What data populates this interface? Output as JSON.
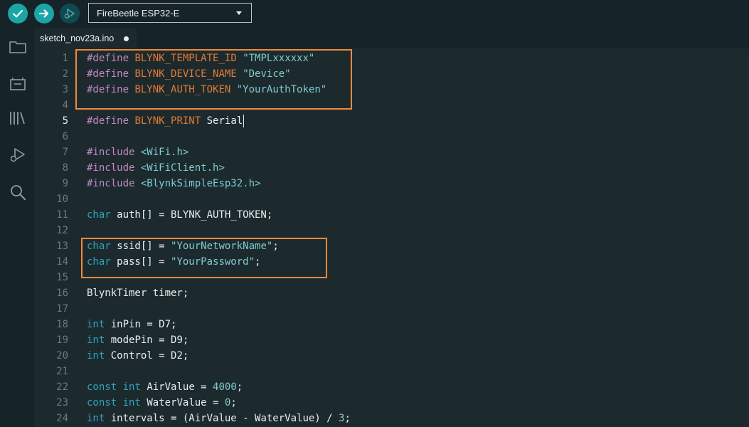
{
  "toolbar": {
    "verify_icon": "checkmark-icon",
    "upload_icon": "arrow-right-icon",
    "debug_icon": "debug-play-icon",
    "board_name": "FireBeetle ESP32-E"
  },
  "sidebar": {
    "icons": [
      "folder-icon",
      "board-manager-icon",
      "library-icon",
      "debug-icon",
      "search-icon"
    ]
  },
  "tab": {
    "filename": "sketch_nov23a.ino",
    "modified_indicator": "dot-icon"
  },
  "editor": {
    "current_line": 5,
    "lines": [
      {
        "n": "1",
        "tokens": [
          [
            "kw",
            "#define"
          ],
          [
            "sp",
            " "
          ],
          [
            "const",
            "BLYNK_TEMPLATE_ID"
          ],
          [
            "sp",
            " "
          ],
          [
            "str",
            "\"TMPLxxxxxx\""
          ]
        ]
      },
      {
        "n": "2",
        "tokens": [
          [
            "kw",
            "#define"
          ],
          [
            "sp",
            " "
          ],
          [
            "const",
            "BLYNK_DEVICE_NAME"
          ],
          [
            "sp",
            " "
          ],
          [
            "str",
            "\"Device\""
          ]
        ]
      },
      {
        "n": "3",
        "tokens": [
          [
            "kw",
            "#define"
          ],
          [
            "sp",
            " "
          ],
          [
            "const",
            "BLYNK_AUTH_TOKEN"
          ],
          [
            "sp",
            " "
          ],
          [
            "str",
            "\"YourAuthToken\""
          ]
        ]
      },
      {
        "n": "4",
        "tokens": []
      },
      {
        "n": "5",
        "tokens": [
          [
            "kw",
            "#define"
          ],
          [
            "sp",
            " "
          ],
          [
            "const",
            "BLYNK_PRINT"
          ],
          [
            "sp",
            " "
          ],
          [
            "id",
            "Serial"
          ]
        ]
      },
      {
        "n": "6",
        "tokens": []
      },
      {
        "n": "7",
        "tokens": [
          [
            "kw",
            "#include"
          ],
          [
            "sp",
            " "
          ],
          [
            "hdr",
            "<WiFi.h>"
          ]
        ]
      },
      {
        "n": "8",
        "tokens": [
          [
            "kw",
            "#include"
          ],
          [
            "sp",
            " "
          ],
          [
            "hdr",
            "<WiFiClient.h>"
          ]
        ]
      },
      {
        "n": "9",
        "tokens": [
          [
            "kw",
            "#include"
          ],
          [
            "sp",
            " "
          ],
          [
            "hdr",
            "<BlynkSimpleEsp32.h>"
          ]
        ]
      },
      {
        "n": "10",
        "tokens": []
      },
      {
        "n": "11",
        "tokens": [
          [
            "type",
            "char"
          ],
          [
            "id",
            " auth[] = BLYNK_AUTH_TOKEN;"
          ]
        ]
      },
      {
        "n": "12",
        "tokens": []
      },
      {
        "n": "13",
        "tokens": [
          [
            "type",
            "char"
          ],
          [
            "id",
            " ssid[] = "
          ],
          [
            "str",
            "\"YourNetworkName\""
          ],
          [
            "id",
            ";"
          ]
        ]
      },
      {
        "n": "14",
        "tokens": [
          [
            "type",
            "char"
          ],
          [
            "id",
            " pass[] = "
          ],
          [
            "str",
            "\"YourPassword\""
          ],
          [
            "id",
            ";"
          ]
        ]
      },
      {
        "n": "15",
        "tokens": []
      },
      {
        "n": "16",
        "tokens": [
          [
            "id",
            "BlynkTimer timer;"
          ]
        ]
      },
      {
        "n": "17",
        "tokens": []
      },
      {
        "n": "18",
        "tokens": [
          [
            "type",
            "int"
          ],
          [
            "id",
            " inPin = D7;"
          ]
        ]
      },
      {
        "n": "19",
        "tokens": [
          [
            "type",
            "int"
          ],
          [
            "id",
            " modePin = D9;"
          ]
        ]
      },
      {
        "n": "20",
        "tokens": [
          [
            "type",
            "int"
          ],
          [
            "id",
            " Control = D2;"
          ]
        ]
      },
      {
        "n": "21",
        "tokens": []
      },
      {
        "n": "22",
        "tokens": [
          [
            "type",
            "const"
          ],
          [
            "id",
            " "
          ],
          [
            "type",
            "int"
          ],
          [
            "id",
            " AirValue = "
          ],
          [
            "num",
            "4000"
          ],
          [
            "id",
            ";"
          ]
        ]
      },
      {
        "n": "23",
        "tokens": [
          [
            "type",
            "const"
          ],
          [
            "id",
            " "
          ],
          [
            "type",
            "int"
          ],
          [
            "id",
            " WaterValue = "
          ],
          [
            "num",
            "0"
          ],
          [
            "id",
            ";"
          ]
        ]
      },
      {
        "n": "24",
        "tokens": [
          [
            "type",
            "int"
          ],
          [
            "id",
            " intervals = (AirValue - WaterValue) / "
          ],
          [
            "num",
            "3"
          ],
          [
            "id",
            ";"
          ]
        ]
      }
    ]
  },
  "highlight_color": "#f08a3c",
  "accent_color": "#1ba5a5"
}
